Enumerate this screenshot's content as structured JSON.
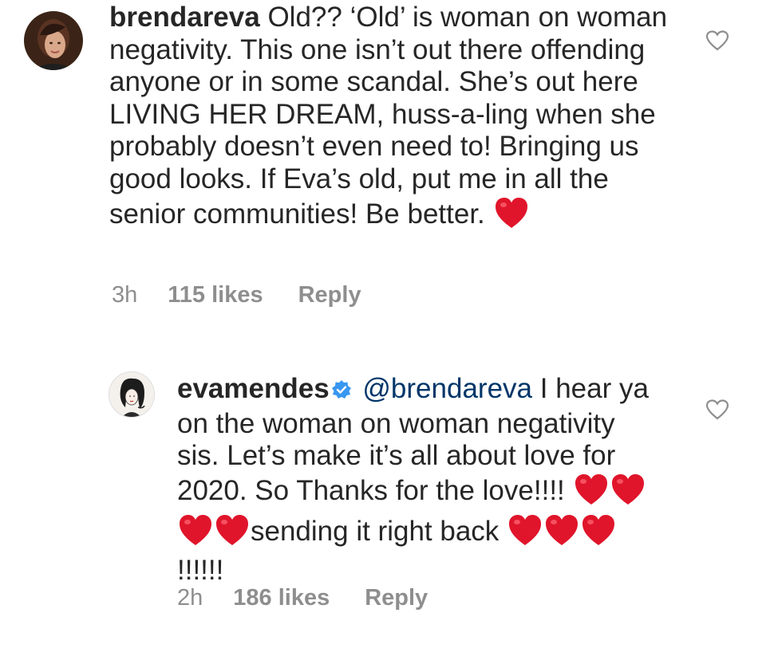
{
  "comments": [
    {
      "username": "brendareva",
      "text_parts": [
        "Old?? ‘Old’ is woman on woman negativity. This one isn’t out there offending anyone or in some scandal. She’s out here LIVING HER DREAM, huss-a-ling when she probably doesn’t even need to! Bringing us good looks. If Eva’s old, put me in all the senior communities!  Be better. "
      ],
      "time": "3h",
      "likes": "115 likes",
      "reply": "Reply",
      "hearts": 1,
      "avatar_icon": "profile-photo-brunette-woman"
    },
    {
      "username": "evamendes",
      "verified": true,
      "mention": "@brendareva",
      "text_a": " I hear ya on the woman on woman negativity sis. Let’s make it’s all about love for 2020. So Thanks for the love!!!! ",
      "text_b": "sending it right back ",
      "text_c": "!!!!!!",
      "time": "2h",
      "likes": "186 likes",
      "reply": "Reply",
      "hearts_a": 4,
      "hearts_b": 3,
      "avatar_icon": "profile-photo-sketch-illustration"
    }
  ],
  "colors": {
    "text": "#262626",
    "meta": "#8e8e8e",
    "mention": "#003569",
    "heart": "#e0152b",
    "verified": "#3897f0"
  },
  "icons": {
    "like": "heart-outline-icon",
    "emoji": "red-heart-emoji",
    "verified": "verified-badge-icon"
  }
}
